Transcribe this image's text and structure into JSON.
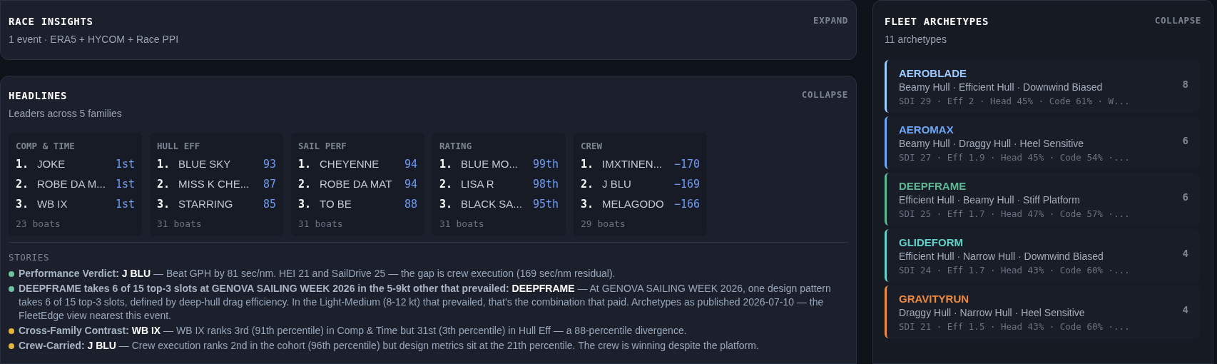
{
  "race_insights": {
    "title": "RACE INSIGHTS",
    "subtitle": "1 event · ERA5 + HYCOM + Race PPI",
    "toggle": "EXPAND"
  },
  "headlines": {
    "title": "HEADLINES",
    "subtitle": "Leaders across 5 families",
    "toggle": "COLLAPSE",
    "families": [
      {
        "name": "COMP & TIME",
        "footer": "23 boats",
        "leaders": [
          {
            "rank": "1.",
            "boat": "JOKE",
            "value": "1st"
          },
          {
            "rank": "2.",
            "boat": "ROBE DA M...",
            "value": "1st"
          },
          {
            "rank": "3.",
            "boat": "WB IX",
            "value": "1st"
          }
        ]
      },
      {
        "name": "HULL EFF",
        "footer": "31 boats",
        "leaders": [
          {
            "rank": "1.",
            "boat": "BLUE SKY",
            "value": "93"
          },
          {
            "rank": "2.",
            "boat": "MISS K CHE...",
            "value": "87"
          },
          {
            "rank": "3.",
            "boat": "STARRING",
            "value": "85"
          }
        ]
      },
      {
        "name": "SAIL PERF",
        "footer": "31 boats",
        "leaders": [
          {
            "rank": "1.",
            "boat": "CHEYENNE",
            "value": "94"
          },
          {
            "rank": "2.",
            "boat": "ROBE DA MAT",
            "value": "94"
          },
          {
            "rank": "3.",
            "boat": "TO BE",
            "value": "88"
          }
        ]
      },
      {
        "name": "RATING",
        "footer": "31 boats",
        "leaders": [
          {
            "rank": "1.",
            "boat": "BLUE MO...",
            "value": "99th"
          },
          {
            "rank": "2.",
            "boat": "LISA R",
            "value": "98th"
          },
          {
            "rank": "3.",
            "boat": "BLACK SA...",
            "value": "95th"
          }
        ]
      },
      {
        "name": "CREW",
        "footer": "29 boats",
        "leaders": [
          {
            "rank": "1.",
            "boat": "IMXTINEN...",
            "value": "−170"
          },
          {
            "rank": "2.",
            "boat": "J BLU",
            "value": "−169"
          },
          {
            "rank": "3.",
            "boat": "MELAGODO",
            "value": "−166"
          }
        ]
      }
    ],
    "stories_title": "STORIES",
    "stories": [
      {
        "color": "#6fc2a0",
        "title": "Performance Verdict:",
        "subject": "J BLU",
        "text": "— Beat GPH by 81 sec/nm. HEI 21 and SailDrive 25 — the gap is crew execution (169 sec/nm residual)."
      },
      {
        "color": "#6fc2a0",
        "title": "DEEPFRAME takes 6 of 15 top-3 slots at GENOVA SAILING WEEK 2026 in the 5-9kt other that prevailed:",
        "subject": "DEEPFRAME",
        "text": "— At GENOVA SAILING WEEK 2026, one design pattern takes 6 of 15 top-3 slots, defined by deep-hull drag efficiency. In the Light-Medium (8-12 kt) that prevailed, that's the combination that paid. Archetypes as published 2026-07-10 — the FleetEdge view nearest this event."
      },
      {
        "color": "#e3b341",
        "title": "Cross-Family Contrast:",
        "subject": "WB IX",
        "text": "— WB IX ranks 3rd (91th percentile) in Comp & Time but 31st (3th percentile) in Hull Eff — a 88-percentile divergence."
      },
      {
        "color": "#e3b341",
        "title": "Crew-Carried:",
        "subject": "J BLU",
        "text": "— Crew execution ranks 2nd in the cohort (96th percentile) but design metrics sit at the 21th percentile. The crew is winning despite the platform."
      }
    ]
  },
  "fleet_archetypes": {
    "title": "FLEET ARCHETYPES",
    "subtitle": "11 archetypes",
    "toggle": "COLLAPSE",
    "archetypes": [
      {
        "name": "AEROBLADE",
        "color": "#9ecbff",
        "traits": "Beamy Hull · Efficient Hull · Downwind Biased",
        "metrics": "SDI 29 · Eff 2 · Head 45% · Code 61% · W...",
        "count": "8"
      },
      {
        "name": "AEROMAX",
        "color": "#6ea8f7",
        "traits": "Beamy Hull · Draggy Hull · Heel Sensitive",
        "metrics": "SDI 27 · Eff 1.9 · Head 45% · Code 54% ·...",
        "count": "6"
      },
      {
        "name": "DEEPFRAME",
        "color": "#5fb894",
        "traits": "Efficient Hull · Beamy Hull · Stiff Platform",
        "metrics": "SDI 25 · Eff 1.7 · Head 47% · Code 57% ·...",
        "count": "6"
      },
      {
        "name": "GLIDEFORM",
        "color": "#5fd3c9",
        "traits": "Efficient Hull · Narrow Hull · Downwind Biased",
        "metrics": "SDI 24 · Eff 1.7 · Head 43% · Code 60% ·...",
        "count": "4"
      },
      {
        "name": "GRAVITYRUN",
        "color": "#ef8a3e",
        "traits": "Draggy Hull · Narrow Hull · Heel Sensitive",
        "metrics": "SDI 21 · Eff 1.5 · Head 43% · Code 60% ·...",
        "count": "4"
      }
    ]
  }
}
